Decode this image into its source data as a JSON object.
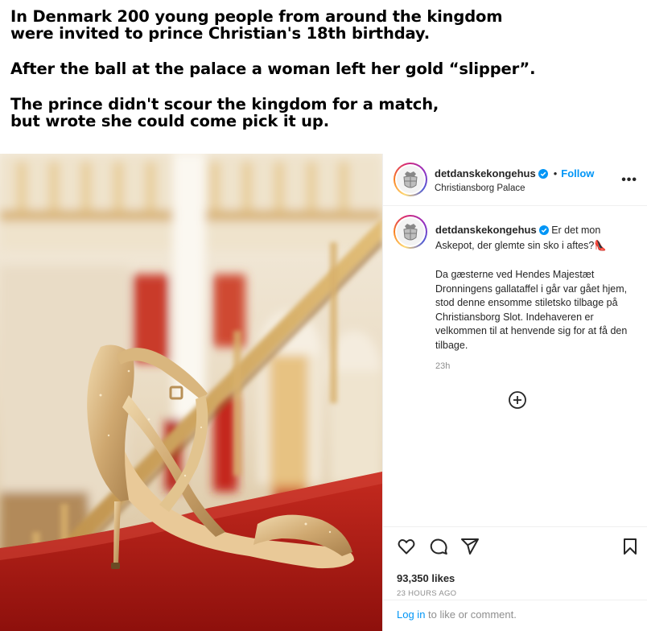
{
  "caption": {
    "line1": "In Denmark 200 young people from around the kingdom",
    "line2": "were invited to prince Christian's 18th birthday.",
    "line3": "After the ball at the palace a woman left her gold “slipper”.",
    "line4": "The prince didn't scour the kingdom for a match,",
    "line5": "but wrote she could come pick it up."
  },
  "post": {
    "username": "detdanskekongehus",
    "follow_label": "Follow",
    "separator": "•",
    "location": "Christiansborg Palace",
    "more_label": "•••",
    "caption_intro": "Er det mon Askepot, der glemte sin sko i aftes?",
    "caption_emoji": "👠",
    "caption_body": "Da gæsterne ved Hendes Majestæt Dronningens gallataffel i går var gået hjem, stod denne ensomme stiletsko tilbage på Christiansborg Slot. Indehaveren er velkommen til at henvende sig for at få den tilbage.",
    "caption_time": "23h",
    "likes": "93,350 likes",
    "time_ago": "23 HOURS AGO",
    "login_link": "Log in",
    "login_rest": " to like or comment."
  },
  "icons": {
    "verified": "verified-badge-icon",
    "more": "more-options-icon",
    "load_more": "plus-circle-icon",
    "like": "heart-icon",
    "comment": "comment-bubble-icon",
    "share": "paper-plane-icon",
    "save": "bookmark-icon"
  },
  "colors": {
    "link_blue": "#0095f6",
    "text": "#262626",
    "muted": "#8e8e8e",
    "carpet_red": "#b01812",
    "gold": "#d4b27c"
  }
}
